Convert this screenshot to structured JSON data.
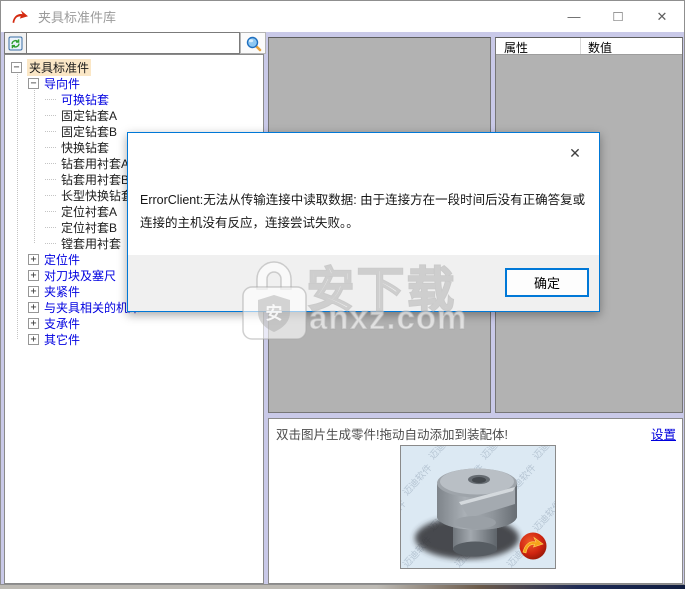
{
  "window": {
    "title": "夹具标准件库",
    "controls": {
      "minimize": "—",
      "maximize": "□",
      "close": "✕"
    }
  },
  "search": {
    "value": "",
    "placeholder": ""
  },
  "tree": {
    "items": [
      {
        "label": "夹具标准件",
        "level": 0,
        "expander": "−",
        "color": "black",
        "selected": true
      },
      {
        "label": "导向件",
        "level": 1,
        "expander": "−",
        "color": "blue",
        "selected": false
      },
      {
        "label": "可换钻套",
        "level": 2,
        "expander": "",
        "color": "blue",
        "selected": false
      },
      {
        "label": "固定钻套A",
        "level": 2,
        "expander": "",
        "color": "black",
        "selected": false
      },
      {
        "label": "固定钻套B",
        "level": 2,
        "expander": "",
        "color": "black",
        "selected": false
      },
      {
        "label": "快换钻套",
        "level": 2,
        "expander": "",
        "color": "black",
        "selected": false
      },
      {
        "label": "钻套用衬套A",
        "level": 2,
        "expander": "",
        "color": "black",
        "selected": false
      },
      {
        "label": "钻套用衬套B",
        "level": 2,
        "expander": "",
        "color": "black",
        "selected": false
      },
      {
        "label": "长型快换钻套",
        "level": 2,
        "expander": "",
        "color": "black",
        "selected": false
      },
      {
        "label": "定位衬套A",
        "level": 2,
        "expander": "",
        "color": "black",
        "selected": false
      },
      {
        "label": "定位衬套B",
        "level": 2,
        "expander": "",
        "color": "black",
        "selected": false
      },
      {
        "label": "镗套用衬套",
        "level": 2,
        "expander": "",
        "color": "black",
        "selected": false
      },
      {
        "label": "定位件",
        "level": 1,
        "expander": "+",
        "color": "blue",
        "selected": false
      },
      {
        "label": "对刀块及塞尺",
        "level": 1,
        "expander": "+",
        "color": "blue",
        "selected": false
      },
      {
        "label": "夹紧件",
        "level": 1,
        "expander": "+",
        "color": "blue",
        "selected": false
      },
      {
        "label": "与夹具相关的机床",
        "level": 1,
        "expander": "+",
        "color": "blue",
        "selected": false
      },
      {
        "label": "支承件",
        "level": 1,
        "expander": "+",
        "color": "blue",
        "selected": false
      },
      {
        "label": "其它件",
        "level": 1,
        "expander": "+",
        "color": "blue",
        "selected": false
      }
    ]
  },
  "properties_panel": {
    "columns": [
      "属性",
      "数值"
    ],
    "rows": []
  },
  "dialog": {
    "message": "ErrorClient:无法从传输连接中读取数据: 由于连接方在一段时间后没有正确答复或连接的主机没有反应，连接尝试失败。。",
    "ok_label": "确定",
    "close_icon": "✕"
  },
  "bottom": {
    "hint": "双击图片生成零件!拖动自动添加到装配体!",
    "settings_label": "设置",
    "image_watermark": "迈迪软件"
  },
  "site_watermark": {
    "text": "安下载",
    "subtext": "anxz.com",
    "lock_glyph": "安"
  },
  "colors": {
    "accent_blue": "#0078d7",
    "tree_blue": "#0000e0",
    "selection_highlight": "#fbe7c6",
    "panel_gray": "#b2b2b2",
    "frame_lavender": "#c9c9e8",
    "link_blue": "#0000dd"
  }
}
